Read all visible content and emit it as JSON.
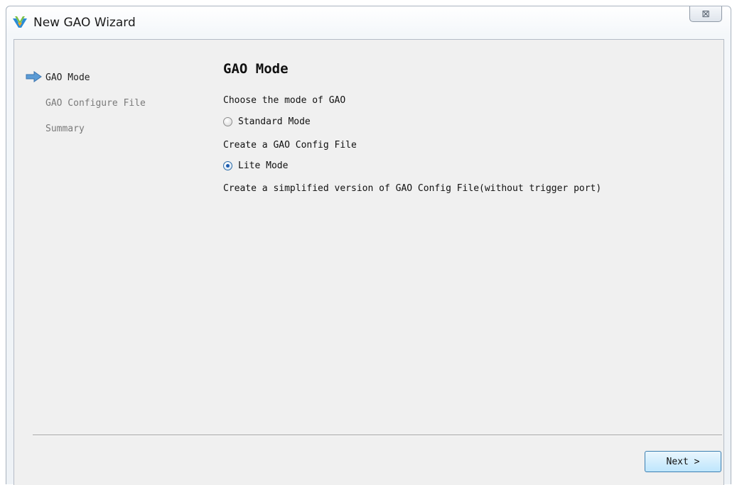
{
  "window": {
    "title": "New GAO Wizard",
    "close_symbol": "⊠",
    "icon": "gowin-logo-icon"
  },
  "steps": [
    {
      "label": "GAO Mode",
      "current": true
    },
    {
      "label": "GAO Configure File",
      "current": false
    },
    {
      "label": "Summary",
      "current": false
    }
  ],
  "page": {
    "heading": "GAO Mode",
    "prompt": "Choose the mode of GAO",
    "options": [
      {
        "label": "Standard Mode",
        "selected": false,
        "description": "Create a GAO Config File"
      },
      {
        "label": "Lite Mode",
        "selected": true,
        "description": "Create a simplified version of GAO Config File(without trigger port)"
      }
    ]
  },
  "footer": {
    "next_label": "Next >"
  },
  "colors": {
    "accent": "#3c7fb1",
    "arrow": "#5b9bd5",
    "client_bg": "#f0f0f0"
  }
}
